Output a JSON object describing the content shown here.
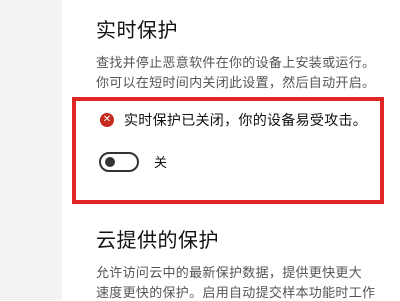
{
  "realtime": {
    "title": "实时保护",
    "description_line1": "查找并停止恶意软件在你的设备上安装或运行。",
    "description_line2": "你可以在短时间内关闭此设置，然后自动开启。",
    "warning_text": "实时保护已关闭，你的设备易受攻击。",
    "warning_icon": "error-x-icon",
    "toggle_state": "off",
    "toggle_label": "关"
  },
  "cloud": {
    "title": "云提供的保护",
    "description_line1": "允许访问云中的最新保护数据，提供更快更大",
    "description_line2": "速度更快的保护。启用自动提交样本功能时工作"
  },
  "colors": {
    "highlight_border": "#e02525",
    "error_icon": "#c42b1c"
  }
}
